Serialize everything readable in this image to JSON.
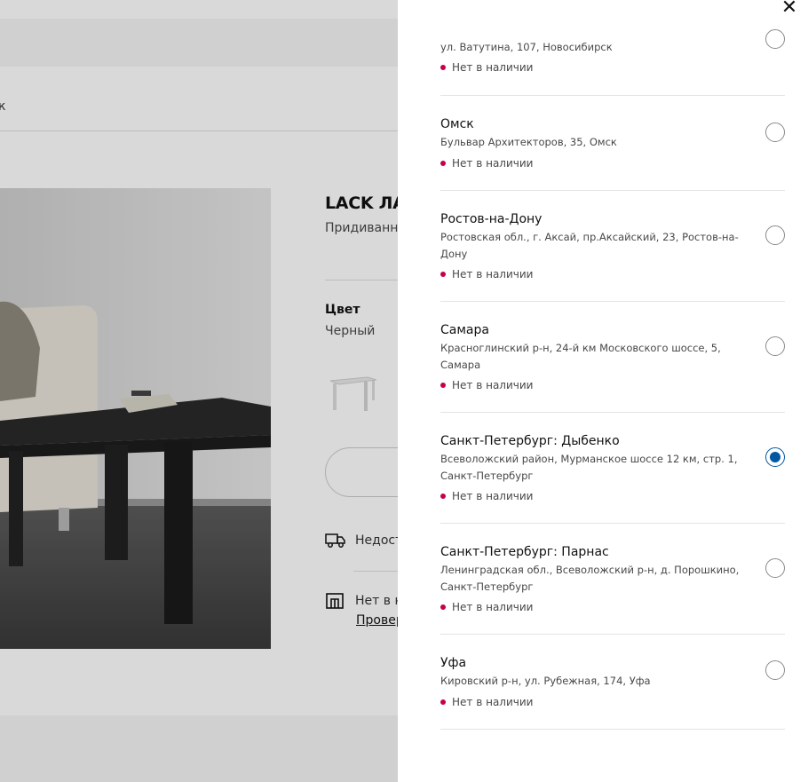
{
  "product_page": {
    "title": "LACK ЛА",
    "subtitle": "Придиванны",
    "color_label": "Цвет",
    "color_value": "Черный",
    "delivery_text": "Недост",
    "store_availability_text": "Нет в н",
    "store_check_link": "Провер",
    "nav_glyph": "к"
  },
  "panel": {
    "close_label": "✕",
    "stores": [
      {
        "name": "",
        "address": "ул. Ватутина, 107, Новосибирск",
        "status": "Нет в наличии",
        "selected": false
      },
      {
        "name": "Омск",
        "address": "Бульвар Архитекторов, 35, Омск",
        "status": "Нет в наличии",
        "selected": false
      },
      {
        "name": "Ростов-на-Дону",
        "address": "Ростовская обл., г. Аксай, пр.Аксайский, 23, Ростов-на-Дону",
        "status": "Нет в наличии",
        "selected": false
      },
      {
        "name": "Самара",
        "address": "Красноглинский р-н, 24-й км Московского шоссе, 5, Самара",
        "status": "Нет в наличии",
        "selected": false
      },
      {
        "name": "Санкт-Петербург: Дыбенко",
        "address": "Всеволожский район, Мурманское шоссе 12 км, стр. 1, Санкт-Петербург",
        "status": "Нет в наличии",
        "selected": true
      },
      {
        "name": "Санкт-Петербург: Парнас",
        "address": "Ленинградская обл., Всеволожский р-н, д. Порошкино, Санкт-Петербург",
        "status": "Нет в наличии",
        "selected": false
      },
      {
        "name": "Уфа",
        "address": "Кировский р-н, ул. Рубежная, 174, Уфа",
        "status": "Нет в наличии",
        "selected": false
      }
    ]
  },
  "icons": {
    "close": "close-icon",
    "delivery": "truck-icon",
    "store": "store-icon",
    "stock_status": "dot-icon",
    "radio": "radio-button"
  },
  "colors": {
    "accent": "#0058a3",
    "out_of_stock": "#c6004a",
    "overlay": "rgba(0,0,0,0.15)"
  }
}
